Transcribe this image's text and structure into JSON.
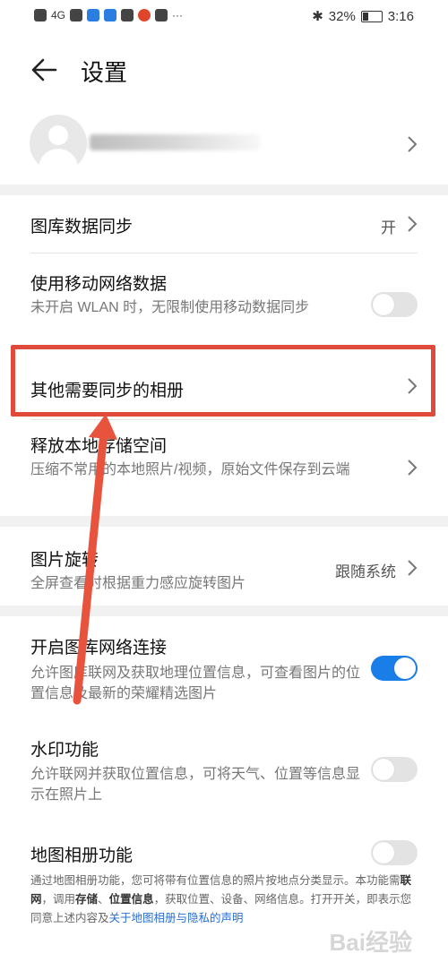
{
  "status_bar": {
    "signal": "4G",
    "battery": "32%",
    "time": "3:16"
  },
  "header": {
    "title": "设置"
  },
  "sync": {
    "label": "图库数据同步",
    "value": "开"
  },
  "mobile_data": {
    "label": "使用移动网络数据",
    "sub": "未开启 WLAN 时，无限制使用移动数据同步",
    "toggle_on": false
  },
  "other_albums": {
    "label": "其他需要同步的相册"
  },
  "free_storage": {
    "label": "释放本地存储空间",
    "sub": "压缩不常用的本地照片/视频，原始文件保存到云端"
  },
  "rotation": {
    "label": "图片旋转",
    "sub": "全屏查看时根据重力感应旋转图片",
    "value": "跟随系统"
  },
  "network": {
    "label": "开启图库网络连接",
    "sub": "允许图库联网及获取地理位置信息，可查看图片的位置信息及最新的荣耀精选图片",
    "toggle_on": true
  },
  "watermark_fn": {
    "label": "水印功能",
    "sub": "允许联网并获取位置信息，可将天气、位置等信息显示在照片上",
    "toggle_on": false
  },
  "map_album": {
    "label": "地图相册功能",
    "toggle_on": false,
    "desc_1": "通过地图相册功能，您可将带有位置信息的照片按地点分类显示。本功能需",
    "desc_b1": "联网",
    "desc_2": "，调用",
    "desc_b2": "存储",
    "desc_3": "、",
    "desc_b3": "位置信息",
    "desc_4": "，获取位置、设备、网络信息。打开开关，即表示您同意上述内容及",
    "desc_link": "关于地图相册与隐私的声明"
  },
  "watermark_text": "Bai经验"
}
